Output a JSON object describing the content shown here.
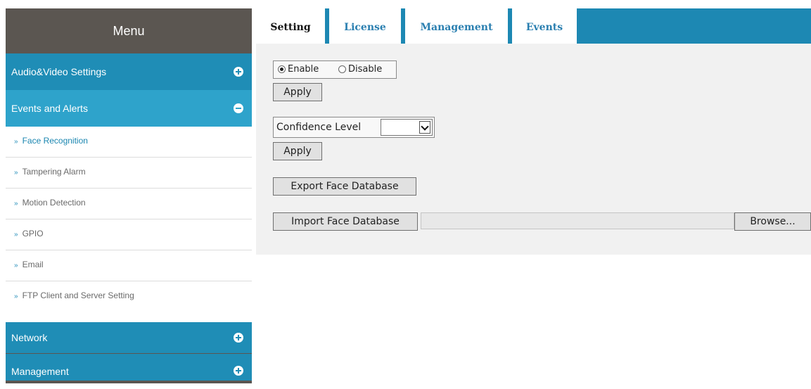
{
  "sidebar": {
    "title": "Menu",
    "groups": [
      {
        "label": "Audio&Video Settings",
        "state": "collapsed"
      },
      {
        "label": "Events and Alerts",
        "state": "expanded"
      },
      {
        "label": "Network",
        "state": "collapsed"
      },
      {
        "label": "Management",
        "state": "collapsed"
      }
    ],
    "subitems": [
      {
        "label": "Face Recognition"
      },
      {
        "label": "Tampering Alarm"
      },
      {
        "label": "Motion Detection"
      },
      {
        "label": "GPIO"
      },
      {
        "label": "Email"
      },
      {
        "label": "FTP Client and Server Setting"
      }
    ],
    "arrow_glyph": "»"
  },
  "tabs": [
    {
      "label": "Setting",
      "active": true
    },
    {
      "label": "License",
      "active": false
    },
    {
      "label": "Management",
      "active": false
    },
    {
      "label": "Events",
      "active": false
    }
  ],
  "form": {
    "enable_label": "Enable",
    "disable_label": "Disable",
    "selected": "Enable",
    "apply_label": "Apply",
    "confidence_label": "Confidence Level",
    "confidence_value": "",
    "export_label": "Export Face Database",
    "import_label": "Import Face Database",
    "browse_label": "Browse...",
    "file_value": ""
  },
  "colors": {
    "sidebar_dark": "#5b5651",
    "group_blue": "#1f8db6",
    "group_active_blue": "#2ea3cb",
    "tabbar_blue": "#1d88b3",
    "content_bg": "#f1f1f1"
  }
}
